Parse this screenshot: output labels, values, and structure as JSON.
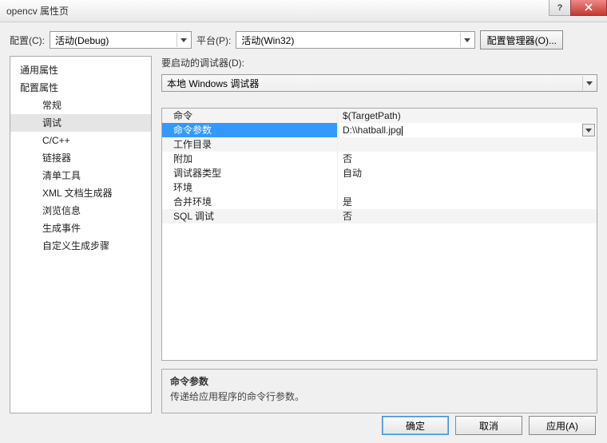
{
  "titlebar": {
    "title": "opencv 属性页"
  },
  "topRow": {
    "configLabel": "配置(C):",
    "configValue": "活动(Debug)",
    "platformLabel": "平台(P):",
    "platformValue": "活动(Win32)",
    "cfgMgrBtn": "配置管理器(O)..."
  },
  "tree": {
    "items": [
      {
        "label": "通用属性",
        "level": 0
      },
      {
        "label": "配置属性",
        "level": 0
      },
      {
        "label": "常规",
        "level": 1
      },
      {
        "label": "调试",
        "level": 1,
        "selected": true
      },
      {
        "label": "C/C++",
        "level": 1
      },
      {
        "label": "链接器",
        "level": 1
      },
      {
        "label": "清单工具",
        "level": 1
      },
      {
        "label": "XML 文档生成器",
        "level": 1
      },
      {
        "label": "浏览信息",
        "level": 1
      },
      {
        "label": "生成事件",
        "level": 1
      },
      {
        "label": "自定义生成步骤",
        "level": 1
      }
    ]
  },
  "debugger": {
    "label": "要启动的调试器(D):",
    "value": "本地 Windows 调试器"
  },
  "grid": {
    "rows": [
      {
        "name": "命令",
        "value": "$(TargetPath)",
        "alt": true
      },
      {
        "name": "命令参数",
        "value": "D:\\\\hatball.jpg",
        "selected": true,
        "editing": true
      },
      {
        "name": "工作目录",
        "value": "",
        "alt": true
      },
      {
        "name": "附加",
        "value": "否"
      },
      {
        "name": "调试器类型",
        "value": "自动"
      },
      {
        "name": "环境",
        "value": ""
      },
      {
        "name": "合并环境",
        "value": "是"
      },
      {
        "name": "SQL 调试",
        "value": "否",
        "alt": true
      }
    ]
  },
  "desc": {
    "title": "命令参数",
    "text": "传递给应用程序的命令行参数。"
  },
  "buttons": {
    "ok": "确定",
    "cancel": "取消",
    "apply": "应用(A)"
  }
}
